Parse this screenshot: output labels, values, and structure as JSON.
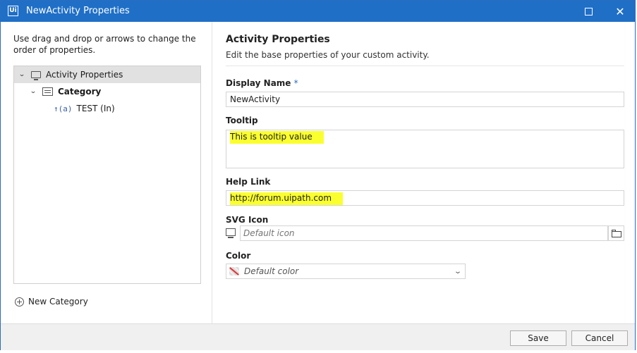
{
  "window": {
    "app_logo": "Ui",
    "title": "NewActivity Properties"
  },
  "left": {
    "hint": "Use drag and drop or arrows to change the order of properties.",
    "tree": [
      {
        "label": "Activity Properties",
        "icon": "monitor-icon",
        "expanded": true,
        "selected": true
      },
      {
        "label": "Category",
        "icon": "category-icon",
        "expanded": true,
        "selected": false
      },
      {
        "label": "TEST (In)",
        "icon": "in-argument-icon",
        "glyph": "↑(a)",
        "selected": false
      }
    ],
    "new_category_label": "New Category"
  },
  "right": {
    "title": "Activity Properties",
    "subtitle": "Edit the base properties of your custom activity.",
    "display_name": {
      "label": "Display Name",
      "required_mark": "*",
      "value": "NewActivity"
    },
    "tooltip": {
      "label": "Tooltip",
      "value": "This is tooltip value"
    },
    "help_link": {
      "label": "Help Link",
      "value": "http://forum.uipath.com"
    },
    "svg_icon": {
      "label": "SVG Icon",
      "placeholder": "Default icon"
    },
    "color": {
      "label": "Color",
      "selected": "Default color"
    }
  },
  "footer": {
    "save_label": "Save",
    "cancel_label": "Cancel"
  },
  "colors": {
    "title_bar": "#1f6fc7",
    "highlight": "#faff2e",
    "required": "#2b6cbf"
  }
}
